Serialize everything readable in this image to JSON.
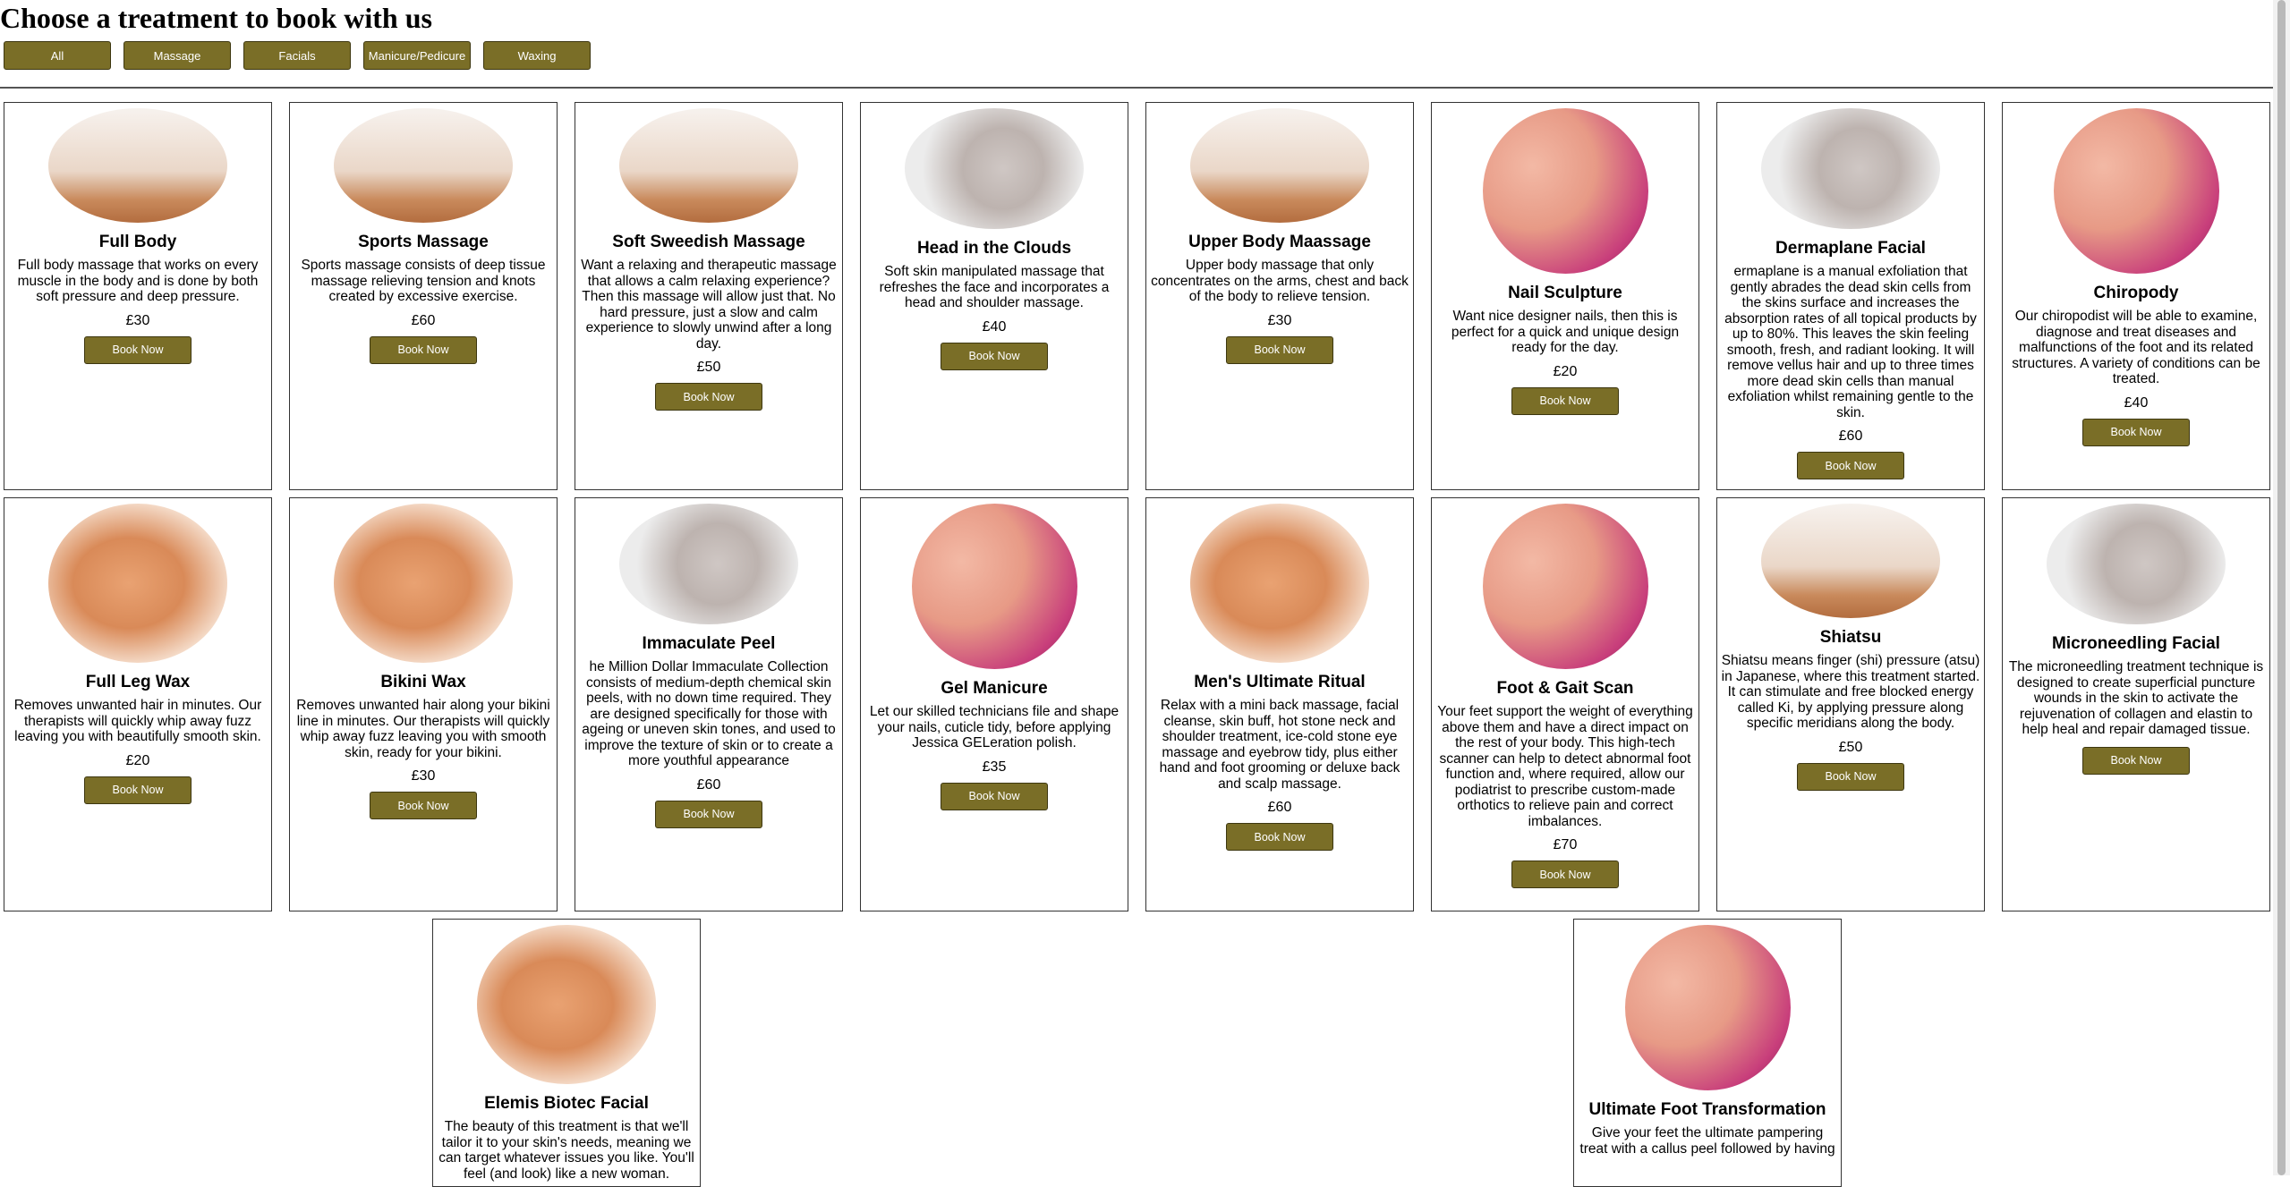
{
  "page": {
    "title": "Choose a treatment to book with us"
  },
  "filters": [
    {
      "label": "All"
    },
    {
      "label": "Massage"
    },
    {
      "label": "Facials"
    },
    {
      "label": "Manicure/Pedicure"
    },
    {
      "label": "Waxing"
    }
  ],
  "book_label": "Book Now",
  "treatments": [
    {
      "name": "Full Body",
      "image": "massage-image",
      "description": "Full body massage that works on every muscle in the body and is done by both soft pressure and deep pressure.",
      "price": "£30"
    },
    {
      "name": "Sports Massage",
      "image": "massage-image",
      "description": "Sports massage consists of deep tissue massage relieving tension and knots created by excessive exercise.",
      "price": "£60"
    },
    {
      "name": "Soft Sweedish Massage",
      "image": "massage-image",
      "description": "Want a relaxing and therapeutic massage that allows a calm relaxing experience? Then this massage will allow just that. No hard pressure, just a slow and calm experience to slowly unwind after a long day.",
      "price": "£50"
    },
    {
      "name": "Head in the Clouds",
      "image": "facial-image",
      "description": "Soft skin manipulated massage that refreshes the face and incorporates a head and shoulder massage.",
      "price": "£40"
    },
    {
      "name": "Upper Body Maassage",
      "image": "massage-image",
      "description": "Upper body massage that only concentrates on the arms, chest and back of the body to relieve tension.",
      "price": "£30"
    },
    {
      "name": "Nail Sculpture",
      "image": "nails-image",
      "description": "Want nice designer nails, then this is perfect for a quick and unique design ready for the day.",
      "price": "£20"
    },
    {
      "name": "Dermaplane Facial",
      "image": "facial-image",
      "description": "ermaplane is a manual exfoliation that gently abrades the dead skin cells from the skins surface and increases the absorption rates of all topical products by up to 80%. This leaves the skin feeling smooth, fresh, and radiant looking. It will remove vellus hair and up to three times more dead skin cells than manual exfoliation whilst remaining gentle to the skin.",
      "price": "£60"
    },
    {
      "name": "Chiropody",
      "image": "nails-image",
      "description": "Our chiropodist will be able to examine, diagnose and treat diseases and malfunctions of the foot and its related structures. A variety of conditions can be treated.",
      "price": "£40"
    },
    {
      "name": "Full Leg Wax",
      "image": "legs-image",
      "description": "Removes unwanted hair in minutes. Our therapists will quickly whip away fuzz leaving you with beautifully smooth skin.",
      "price": "£20"
    },
    {
      "name": "Bikini Wax",
      "image": "legs-image",
      "description": "Removes unwanted hair along your bikini line in minutes. Our therapists will quickly whip away fuzz leaving you with smooth skin, ready for your bikini.",
      "price": "£30"
    },
    {
      "name": "Immaculate Peel",
      "image": "facial-image",
      "description": "he Million Dollar Immaculate Collection consists of medium-depth chemical skin peels, with no down time required. They are designed specifically for those with ageing or uneven skin tones, and used to improve the texture of skin or to create a more youthful appearance",
      "price": "£60"
    },
    {
      "name": "Gel Manicure",
      "image": "nails-image",
      "description": "Let our skilled technicians file and shape your nails, cuticle tidy, before applying Jessica GELeration polish.",
      "price": "£35"
    },
    {
      "name": "Men's Ultimate Ritual",
      "image": "legs-image",
      "description": "Relax with a mini back massage, facial cleanse, skin buff, hot stone neck and shoulder treatment, ice-cold stone eye massage and eyebrow tidy, plus either hand and foot grooming or deluxe back and scalp massage.",
      "price": "£60"
    },
    {
      "name": "Foot & Gait Scan",
      "image": "nails-image",
      "description": "Your feet support the weight of everything above them and have a direct impact on the rest of your body. This high-tech scanner can help to detect abnormal foot function and, where required, allow our podiatrist to prescribe custom-made orthotics to relieve pain and correct imbalances.",
      "price": "£70"
    },
    {
      "name": "Shiatsu",
      "image": "massage-image",
      "description": "Shiatsu means finger (shi) pressure (atsu) in Japanese, where this treatment started. It can stimulate and free blocked energy called Ki, by applying pressure along specific meridians along the body.",
      "price": "£50"
    },
    {
      "name": "Microneedling Facial",
      "image": "facial-image",
      "description": "The microneedling treatment technique is designed to create superficial puncture wounds in the skin to activate the rejuvenation of collagen and elastin to help heal and repair damaged tissue.",
      "price": ""
    },
    {
      "name": "Elemis Biotec Facial",
      "image": "legs-image",
      "description": "The beauty of this treatment is that we'll tailor it to your skin's needs, meaning we can target whatever issues you like. You'll feel (and look) like a new woman.",
      "price": ""
    },
    {
      "name": "Ultimate Foot Transformation",
      "image": "nails-image",
      "description": "Give your feet the ultimate pampering treat with a callus peel followed by having",
      "price": ""
    }
  ]
}
